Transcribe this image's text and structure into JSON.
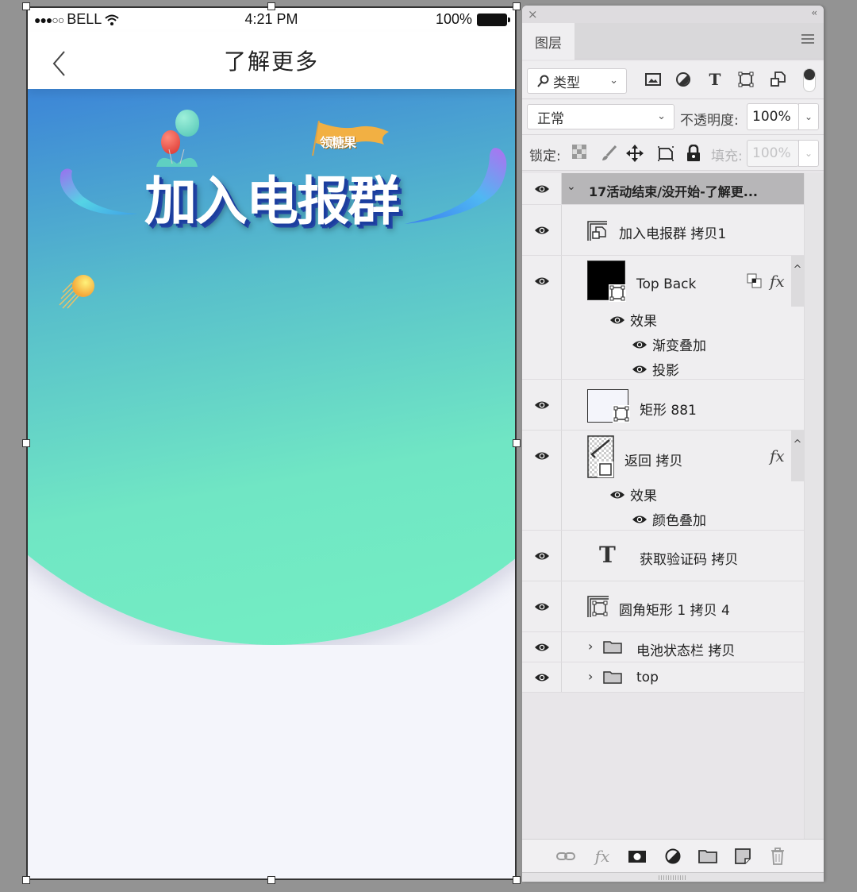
{
  "artboard": {
    "statusbar": {
      "carrier": "BELL",
      "signal": "●●●○○",
      "time": "4:21 PM",
      "battery": "100%"
    },
    "navbar": {
      "title": "了解更多",
      "back_icon": "chevron-left-icon"
    },
    "banner": {
      "title": "加入电报群",
      "flag_text": "领糖果"
    },
    "colors": {
      "gradient_top": "#2454e3",
      "gradient_bottom": "#74f0c2",
      "page_bg": "#f4f5fb"
    }
  },
  "panel": {
    "close_label": "×",
    "collapse_label": "‹‹",
    "tab_label": "图层",
    "filter": {
      "kind_label": "类型",
      "icons": [
        "image-filter-icon",
        "adjustment-filter-icon",
        "type-filter-icon",
        "shape-filter-icon",
        "smart-object-filter-icon"
      ]
    },
    "blend_mode": "正常",
    "opacity_label": "不透明度:",
    "opacity_value": "100%",
    "lock_label": "锁定:",
    "fill_label": "填充:",
    "fill_value": "100%",
    "layers": [
      {
        "name": "17活动结束/没开始-了解更...",
        "type": "group-open",
        "visible": true
      },
      {
        "name": "加入电报群 拷贝1",
        "type": "smart-object",
        "visible": true
      },
      {
        "name": "Top Back",
        "type": "shape",
        "visible": true,
        "fx": "fx",
        "effects_label": "效果",
        "effects": [
          "渐变叠加",
          "投影"
        ]
      },
      {
        "name": "矩形 881",
        "type": "shape",
        "visible": true
      },
      {
        "name": "返回 拷贝",
        "type": "shape",
        "visible": true,
        "fx": "fx",
        "effects_label": "效果",
        "effects": [
          "颜色叠加"
        ]
      },
      {
        "name": "获取验证码 拷贝",
        "type": "text",
        "visible": true,
        "type_glyph": "T"
      },
      {
        "name": "圆角矩形 1 拷贝 4",
        "type": "shape",
        "visible": true
      },
      {
        "name": "电池状态栏 拷贝",
        "type": "group-closed",
        "visible": true
      },
      {
        "name": "top",
        "type": "group-closed",
        "visible": true
      }
    ],
    "bottom_icons": [
      "link-icon",
      "fx-icon",
      "mask-icon",
      "adjustment-icon",
      "folder-icon",
      "new-layer-icon",
      "trash-icon"
    ],
    "fx_text": "fx",
    "type_glyph": "T"
  }
}
